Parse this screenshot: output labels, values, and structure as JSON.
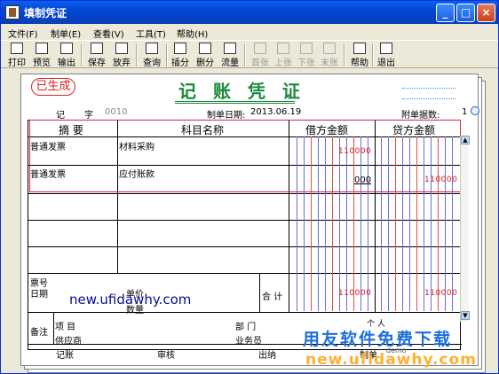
{
  "window": {
    "title": "填制凭证",
    "buttons": {
      "minimize": "_",
      "maximize": "□",
      "close": "×"
    }
  },
  "menu": [
    "文件(F)",
    "制单(E)",
    "查看(V)",
    "工具(T)",
    "帮助(H)"
  ],
  "toolbar": [
    {
      "label": "打印",
      "icon": "printer-icon",
      "enabled": true
    },
    {
      "label": "预览",
      "icon": "preview-icon",
      "enabled": true
    },
    {
      "label": "输出",
      "icon": "export-icon",
      "enabled": true
    },
    {
      "label": "保存",
      "icon": "save-icon",
      "enabled": true
    },
    {
      "label": "放弃",
      "icon": "undo-icon",
      "enabled": true
    },
    {
      "label": "查询",
      "icon": "binoculars-icon",
      "enabled": true
    },
    {
      "label": "插分",
      "icon": "insert-row-icon",
      "enabled": true
    },
    {
      "label": "删分",
      "icon": "delete-row-icon",
      "enabled": true
    },
    {
      "label": "流量",
      "icon": "flow-icon",
      "enabled": true
    },
    {
      "label": "首张",
      "icon": "first-icon",
      "enabled": false
    },
    {
      "label": "上张",
      "icon": "prev-icon",
      "enabled": false
    },
    {
      "label": "下张",
      "icon": "next-icon",
      "enabled": false
    },
    {
      "label": "末张",
      "icon": "last-icon",
      "enabled": false
    },
    {
      "label": "帮助",
      "icon": "help-icon",
      "enabled": true
    },
    {
      "label": "退出",
      "icon": "exit-icon",
      "enabled": true
    }
  ],
  "voucher": {
    "stamp": "已生成",
    "title": "记 账 凭 证",
    "type_label": "记",
    "number_label": "字",
    "number": "0010",
    "date_label": "制单日期:",
    "date": "2013.06.19",
    "attachments_label": "附单据数:",
    "attachments": "1",
    "headers": {
      "summary": "摘 要",
      "account": "科目名称",
      "debit": "借方金额",
      "credit": "贷方金额"
    },
    "rows": [
      {
        "summary": "普通发票",
        "account": "材料采购",
        "debit": "110000",
        "credit": ""
      },
      {
        "summary": "普通发票",
        "account": "应付账款",
        "debit": "000",
        "credit": "110000"
      }
    ],
    "ticket_label": "票号",
    "date_row_label": "日期",
    "unit_price_label": "单价",
    "quantity_label": "数量",
    "total_label": "合 计",
    "total_debit": "110000",
    "total_credit": "110000",
    "remark_label": "备注",
    "project_label": "项 目",
    "dept_label": "部 门",
    "supplier_label": "供应商",
    "salesman_label": "业务员",
    "person_label": "个 人",
    "demo_label": "demo",
    "bottom": {
      "bookkeep": "记账",
      "audit": "审核",
      "cashier": "出纳",
      "maker": "制单"
    }
  },
  "watermarks": {
    "site1": "new.ufidawhy.com",
    "brand": "用友软件免费下载",
    "site2": "new.ufidawhy.com"
  }
}
